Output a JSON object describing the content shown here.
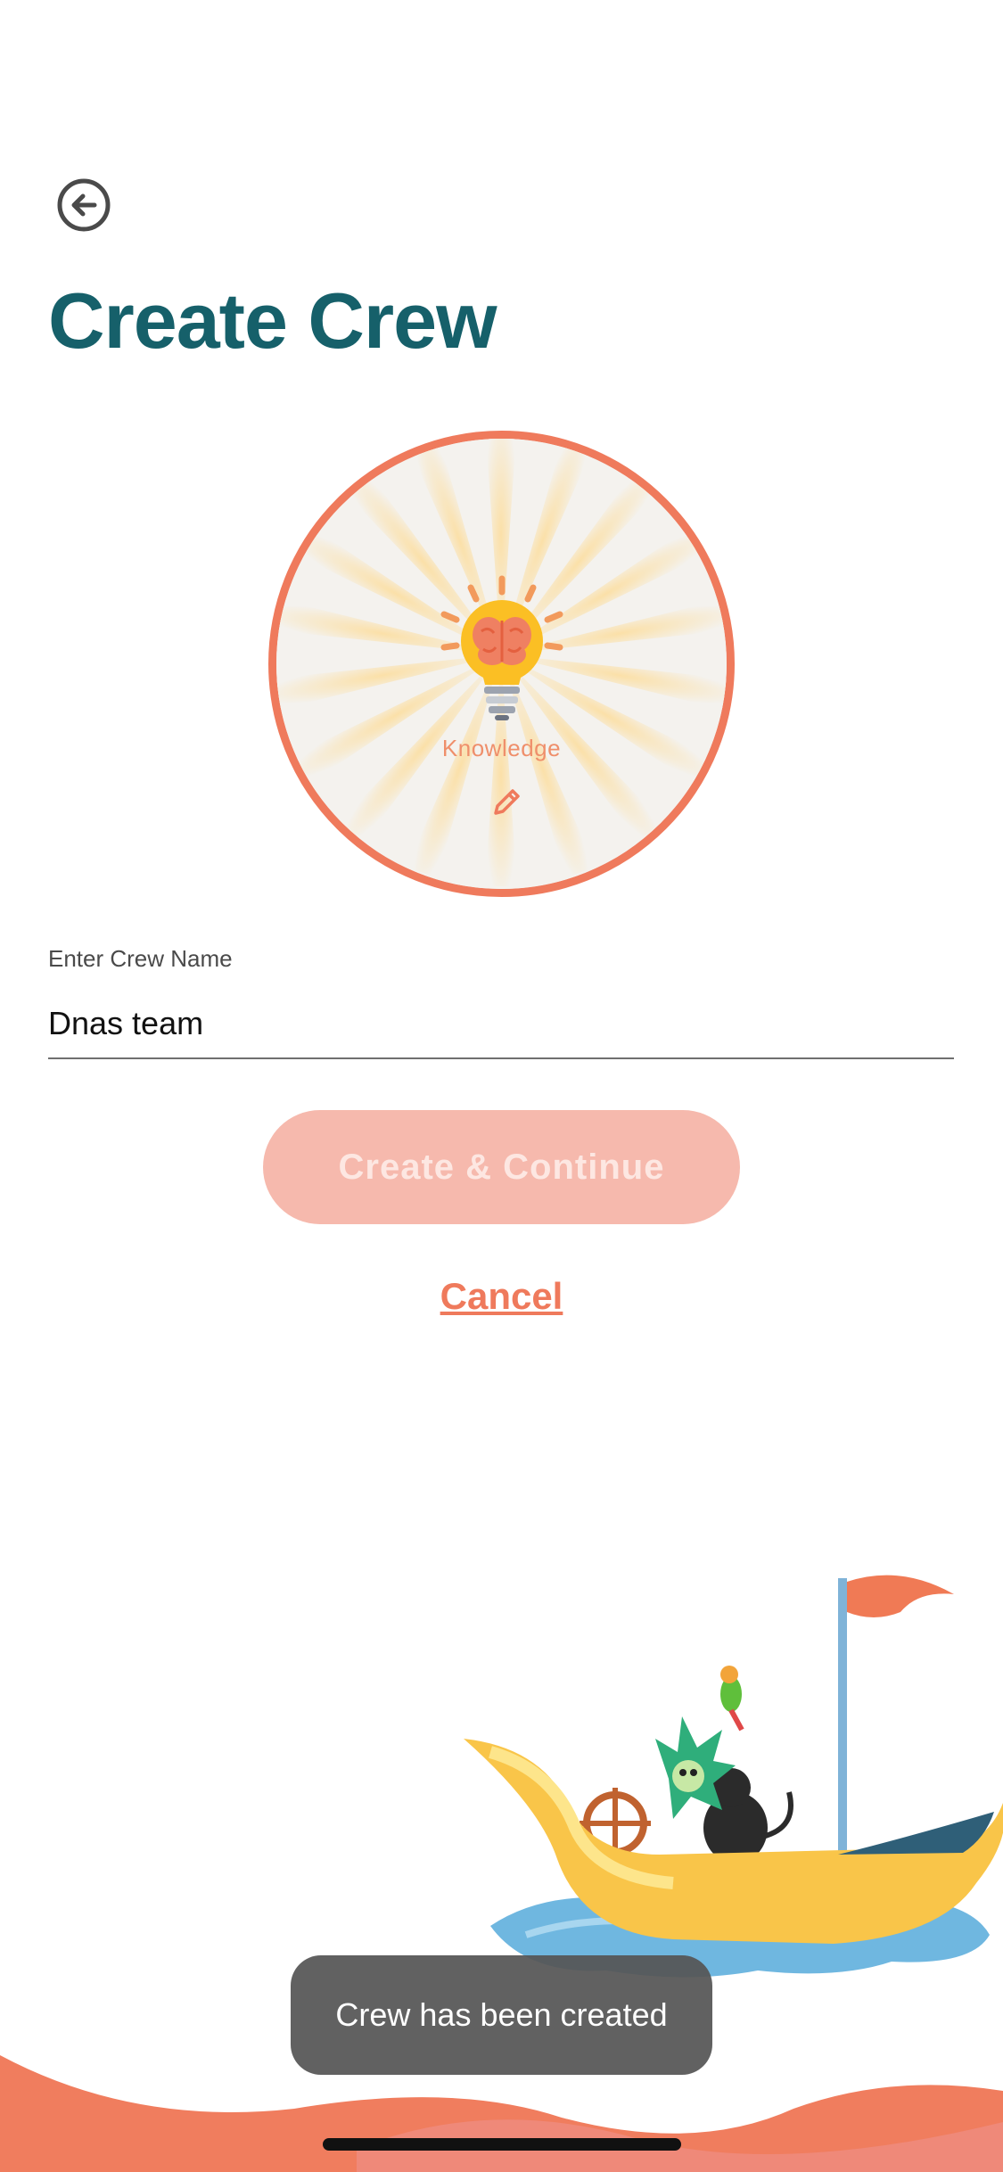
{
  "header": {
    "back_icon": "back-arrow-circle-icon",
    "title": "Create Crew"
  },
  "avatar": {
    "category_label": "Knowledge",
    "icon": "lightbulb-brain-icon",
    "edit_icon": "pencil-icon",
    "ring_color": "#ef7a5c"
  },
  "form": {
    "crew_name_label": "Enter Crew Name",
    "crew_name_value": "Dnas team"
  },
  "actions": {
    "primary_label": "Create & Continue",
    "cancel_label": "Cancel"
  },
  "toast": {
    "message": "Crew has been created"
  },
  "colors": {
    "title": "#16606a",
    "accent": "#ef7a5c",
    "button_disabled_bg": "#f6b9ad"
  }
}
